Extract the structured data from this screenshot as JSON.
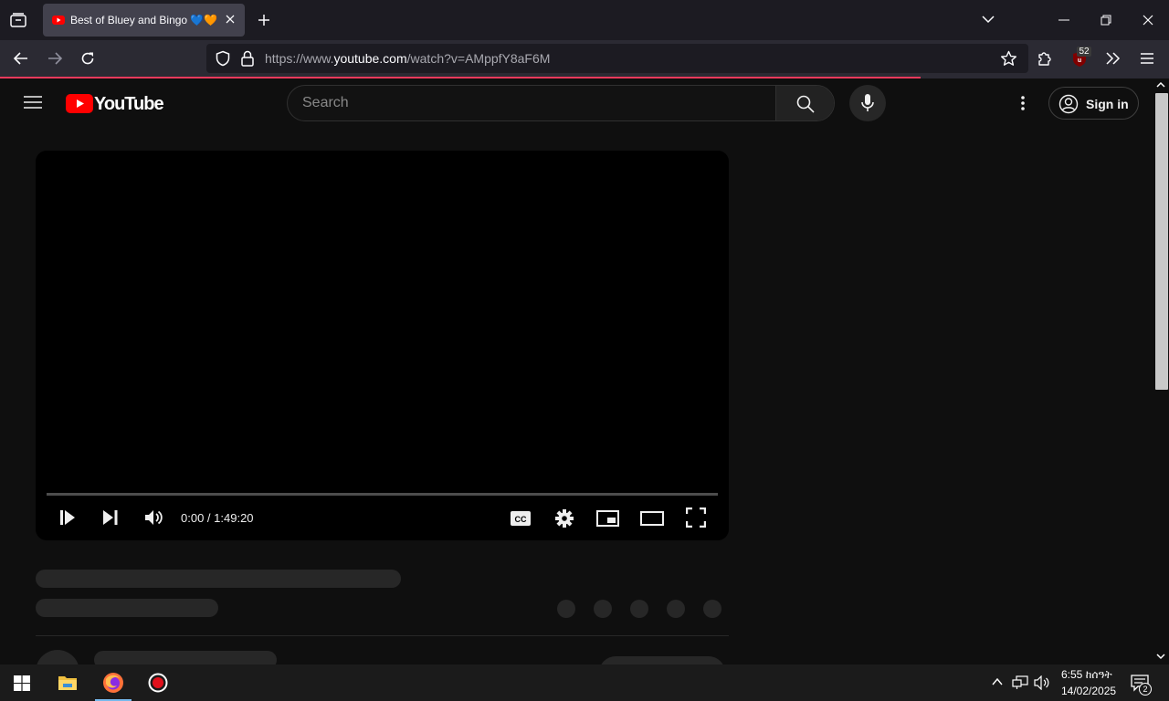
{
  "browser": {
    "tab_title": "Best of Bluey and Bingo 💙🧡",
    "url_prefix": "https://www.",
    "url_domain": "youtube.com",
    "url_path": "/watch?v=AMppfY8aF6M",
    "extension_badge": "52"
  },
  "youtube": {
    "logo_text": "YouTube",
    "search_placeholder": "Search",
    "signin_label": "Sign in"
  },
  "player": {
    "time_current": "0:00",
    "time_separator": " / ",
    "time_total": "1:49:20",
    "progress": 0
  },
  "taskbar": {
    "time": "6:55 ከሰዓት",
    "date": "14/02/2025",
    "notification_count": "2"
  },
  "colors": {
    "accent": "#ff0000",
    "loading_bar": "#ee3a5c",
    "background": "#0f0f0f"
  }
}
